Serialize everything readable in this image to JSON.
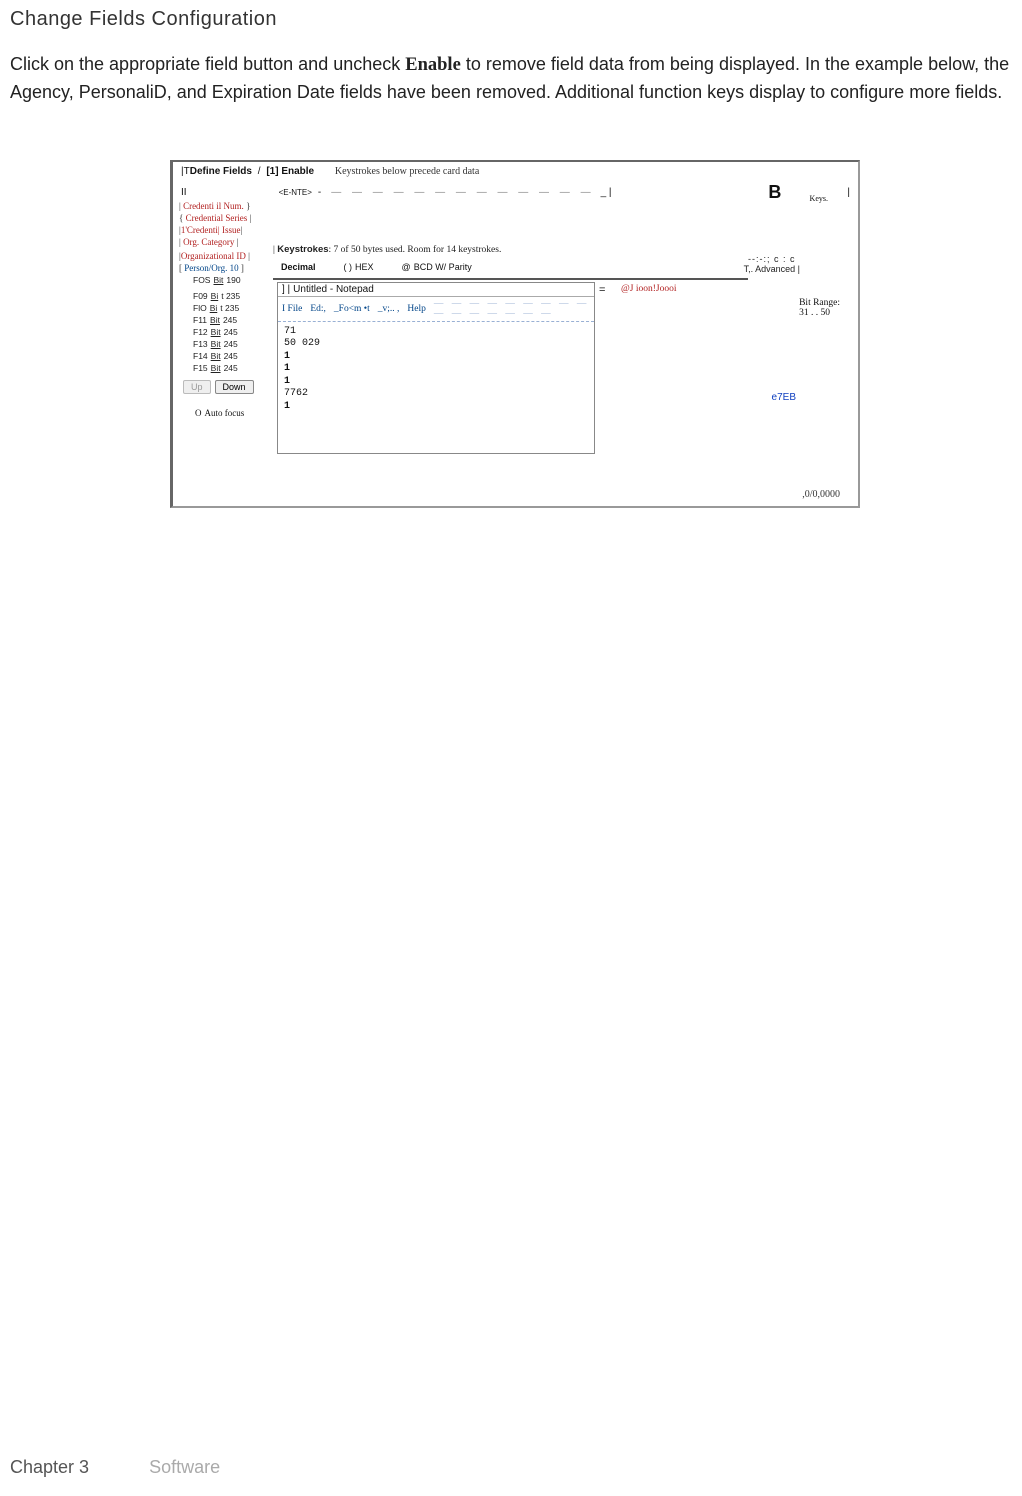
{
  "page": {
    "title": "Change Fields Configuration",
    "paragraph_before_enable": "Click on the appropriate field button and uncheck ",
    "enable_word": "Enable",
    "paragraph_after_enable": " to remove field data from being displayed. In the example below, the Agency, PersonaliD, and Expiration Date fields have been removed. Additional function keys display to configure more fields."
  },
  "figure": {
    "define_fields": "Define Fields",
    "slash": "/",
    "enable_chip": "[1] Enable",
    "precede": "Keystrokes below precede card data",
    "enter_label": "<E-NTE>",
    "dashes": "— — — — — — — — — — — — —",
    "big_b": "B",
    "keys_label": "Keys.",
    "side_buttons": [
      {
        "label": "Credenti il Num.",
        "class": ""
      },
      {
        "label": "Credential Series",
        "class": ""
      },
      {
        "label": "1'Credenti| Issue",
        "class": ""
      },
      {
        "label": "Org. Category",
        "class": ""
      },
      {
        "label": "Organizational ID",
        "class": "margin-top"
      },
      {
        "label": "Person/Org. 10",
        "class": "blue"
      }
    ],
    "fos_row": {
      "f": "FOS",
      "bit": "Bit",
      "num": "190"
    },
    "bit_list": [
      {
        "f": "F09",
        "bit": "Bi",
        "num": "t 235"
      },
      {
        "f": "FlO",
        "bit": "Bi",
        "num": "t 235"
      },
      {
        "f": "F11",
        "bit": "Bit",
        "num": "245"
      },
      {
        "f": "F12",
        "bit": "Bit",
        "num": "245"
      },
      {
        "f": "F13",
        "bit": "Bit",
        "num": "245"
      },
      {
        "f": "F14",
        "bit": "Bit",
        "num": "245"
      },
      {
        "f": "F15",
        "bit": "Bit",
        "num": "245"
      }
    ],
    "up_btn": "Up",
    "down_btn": "Down",
    "autofocus": "Auto focus",
    "ks_line_prefix": "Keystrokes",
    "ks_line_rest": ": 7 of 50 bytes used. Room for 14 keystrokes.",
    "radios": {
      "decimal": "Decimal",
      "hex": "HEX",
      "bcd": "BCD W/ Parity"
    },
    "advanced_garble": "--:-:; c : c",
    "advanced_label": ",. Advanced",
    "notepad": {
      "title": "Untitled - Notepad",
      "menu": {
        "file": "I File",
        "edit": "Ed:,",
        "format": "_Fo<m •t",
        "view": "_v;.. ,",
        "help": "Help"
      },
      "lines": [
        "71",
        "50 029",
        "1",
        "1",
        "1",
        "7762",
        "1"
      ]
    },
    "np_right_symbol": "=",
    "np_right_text": "@J ioon!Joooi",
    "bit_range_label": "Bit Range:",
    "bit_range_value": "31 . . 50",
    "e7eb": "e7EB",
    "bottom_num": ",0/0,0000"
  },
  "footer": {
    "chapter": "Chapter 3",
    "software": "Software"
  }
}
